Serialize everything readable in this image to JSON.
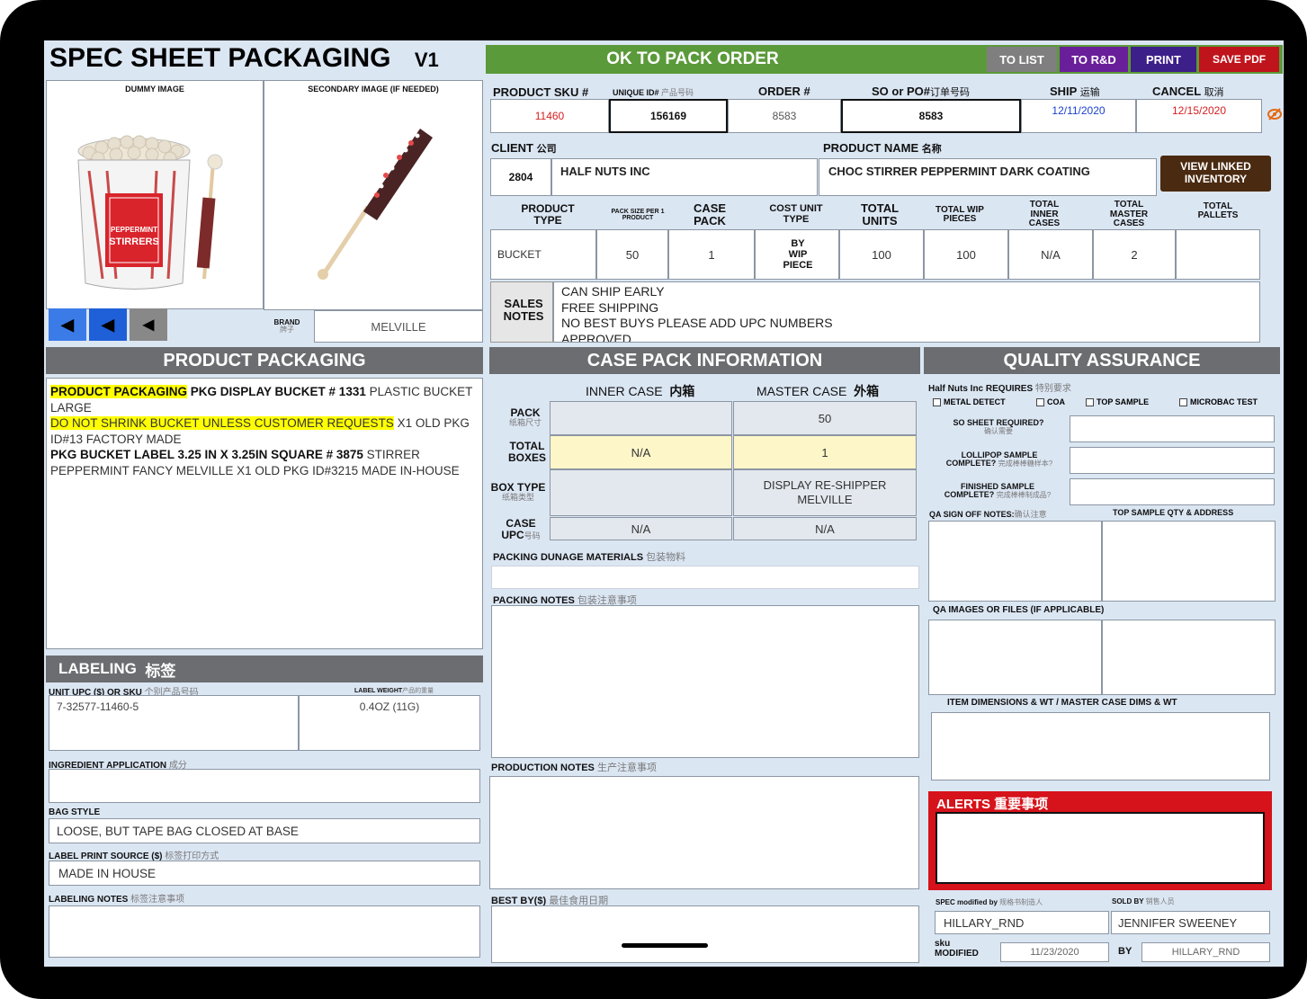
{
  "title": "SPEC SHEET PACKAGING",
  "version": "V1",
  "status_banner": "OK TO PACK ORDER",
  "toolbar": {
    "to_list": "TO LIST",
    "to_rnd": "TO R&D",
    "print": "PRINT",
    "save_pdf": "SAVE PDF"
  },
  "images": {
    "dummy_label": "DUMMY IMAGE",
    "secondary_label": "SECONDARY IMAGE (IF NEEDED)",
    "product_label_text": "PEPPERMINT STIRRERS"
  },
  "brand": {
    "label": "BRAND",
    "label_cn": "牌子",
    "value": "MELVILLE"
  },
  "order": {
    "headers": {
      "product_sku": "PRODUCT SKU #",
      "unique_id": "UNIQUE ID#",
      "unique_id_cn": "产品号码",
      "order_no": "ORDER #",
      "so_po": "SO or PO#",
      "so_po_cn": "订单号码",
      "ship": "SHIP",
      "ship_cn": "运输",
      "cancel": "CANCEL",
      "cancel_cn": "取消"
    },
    "values": {
      "product_sku": "11460",
      "unique_id": "156169",
      "order_no": "8583",
      "so_po": "8583",
      "ship": "12/11/2020",
      "cancel": "12/15/2020"
    }
  },
  "client": {
    "label": "CLIENT",
    "label_cn": "公司",
    "code": "2804",
    "name": "HALF NUTS INC"
  },
  "product_name": {
    "label": "PRODUCT NAME",
    "label_cn": "名称",
    "value": "CHOC STIRRER PEPPERMINT DARK COATING"
  },
  "view_inventory": {
    "line1": "VIEW LINKED",
    "line2": "INVENTORY"
  },
  "metrics": {
    "headers": {
      "product_type": "PRODUCT TYPE",
      "pack_size": "PACK SIZE PER 1 PRODUCT",
      "case_pack": "CASE PACK",
      "cost_unit_type": "COST UNIT TYPE",
      "total_units": "TOTAL UNITS",
      "total_wip": "TOTAL WIP PIECES",
      "total_inner": "TOTAL INNER CASES",
      "total_master": "TOTAL MASTER CASES",
      "total_pallets": "TOTAL PALLETS"
    },
    "values": {
      "product_type": "BUCKET",
      "pack_size": "50",
      "case_pack": "1",
      "cost_unit_type": "BY WIP PIECE",
      "total_units": "100",
      "total_wip": "100",
      "total_inner": "N/A",
      "total_master": "2",
      "total_pallets": ""
    }
  },
  "sales_notes": {
    "label": "SALES NOTES",
    "lines": [
      "CAN SHIP EARLY",
      "FREE SHIPPING",
      "NO BEST BUYS  PLEASE ADD UPC NUMBERS",
      "APPROVED"
    ]
  },
  "product_packaging": {
    "header": "PRODUCT PACKAGING",
    "t1": "PRODUCT PACKAGING",
    "t2": " PKG DISPLAY BUCKET # 1331 ",
    "t3": "PLASTIC BUCKET LARGE",
    "t4": "DO NOT SHRINK BUCKET UNLESS CUSTOMER REQUESTS",
    "t5": " X1  OLD PKG ID#13 FACTORY MADE",
    "t6": "PKG BUCKET LABEL 3.25 IN X 3.25IN SQUARE # 3875",
    "t7": " STIRRER PEPPERMINT FANCY MELVILLE X1  OLD PKG ID#3215 MADE IN-HOUSE"
  },
  "labeling": {
    "header": "LABELING",
    "header_cn": "标签",
    "unit_upc_label": "UNIT UPC ($) OR SKU",
    "unit_upc_cn": "个别产品号码",
    "label_weight_label": "LABEL WEIGHT",
    "label_weight_cn": "产品的重量",
    "unit_upc": "7-32577-11460-5",
    "label_weight": "0.4OZ (11G)",
    "ingredient_label": "INGREDIENT APPLICATION",
    "ingredient_cn": "成分",
    "ingredient": "",
    "bag_style_label": "BAG STYLE",
    "bag_style": "LOOSE, BUT TAPE BAG CLOSED AT BASE",
    "print_source_label": "LABEL PRINT SOURCE ($)",
    "print_source_cn": "标签打印方式",
    "print_source": "MADE IN HOUSE",
    "notes_label": "LABELING NOTES",
    "notes_cn": "标签注意事项",
    "notes": ""
  },
  "case_pack": {
    "header": "CASE PACK INFORMATION",
    "inner_label": "INNER CASE",
    "inner_cn": "内箱",
    "master_label": "MASTER CASE",
    "master_cn": "外箱",
    "rows": {
      "pack": {
        "label": "PACK",
        "cn": "纸箱尺寸",
        "inner": "",
        "master": "50"
      },
      "total_boxes": {
        "label": "TOTAL BOXES",
        "inner": "N/A",
        "master": "1"
      },
      "box_type": {
        "label": "BOX TYPE",
        "cn": "纸箱类型",
        "inner": "",
        "master": "DISPLAY RE-SHIPPER MELVILLE"
      },
      "case_upc": {
        "label": "CASE",
        "label2": "UPC",
        "cn": "号码",
        "inner": "N/A",
        "master": "N/A"
      }
    },
    "dunnage_label": "PACKING DUNAGE MATERIALS",
    "dunnage_cn": "包装物料",
    "packing_notes_label": "PACKING NOTES",
    "packing_notes_cn": "包装注意事项",
    "production_notes_label": "PRODUCTION NOTES",
    "production_notes_cn": "生产注意事项",
    "best_by_label": "BEST BY($)",
    "best_by_cn": "最佳食用日期"
  },
  "qa": {
    "header": "QUALITY ASSURANCE",
    "requires_label": "Half Nuts Inc  REQUIRES",
    "requires_cn": "特别要求",
    "checkboxes": [
      "METAL DETECT",
      "COA",
      "TOP SAMPLE",
      "MICROBAC TEST"
    ],
    "so_sheet_label": "SO SHEET REQUIRED?",
    "so_sheet_cn": "确认需要",
    "lollipop_label1": "LOLLIPOP SAMPLE",
    "lollipop_label2": "COMPLETE?",
    "lollipop_cn": "完成棒棒糖样本?",
    "finished_label1": "FINISHED SAMPLE",
    "finished_label2": "COMPLETE?",
    "finished_cn": "完成棒棒制成品?",
    "signoff_label": "QA SIGN OFF NOTES:",
    "signoff_cn": "确认注意",
    "top_sample_label": "TOP SAMPLE QTY & ADDRESS",
    "images_label": "QA IMAGES OR FILES (IF APPLICABLE)",
    "dims_label": "ITEM DIMENSIONS & WT / MASTER CASE DIMS & WT"
  },
  "alerts": {
    "label": "ALERTS",
    "label_cn": "重要事项",
    "value": ""
  },
  "spec_meta": {
    "modified_by_label": "SPEC modified by",
    "modified_by_cn": "规格书制造人",
    "sold_by_label": "SOLD BY",
    "sold_by_cn": "销售人员",
    "modified_by": "HILLARY_RND",
    "sold_by": "JENNIFER SWEENEY",
    "sku_label": "sku",
    "modified_label": "MODIFIED",
    "modified_date": "11/23/2020",
    "by_label": "BY",
    "by_value": "HILLARY_RND"
  },
  "colors": {
    "banner_green": "#5b9a3a",
    "to_list": "#7f7f7f",
    "to_rnd": "#6a1f9a",
    "print": "#3d1f8a",
    "save_pdf": "#c0141c",
    "alert_red": "#d6121a",
    "highlight": "#ffff00",
    "section_gray": "#6b6d70"
  }
}
